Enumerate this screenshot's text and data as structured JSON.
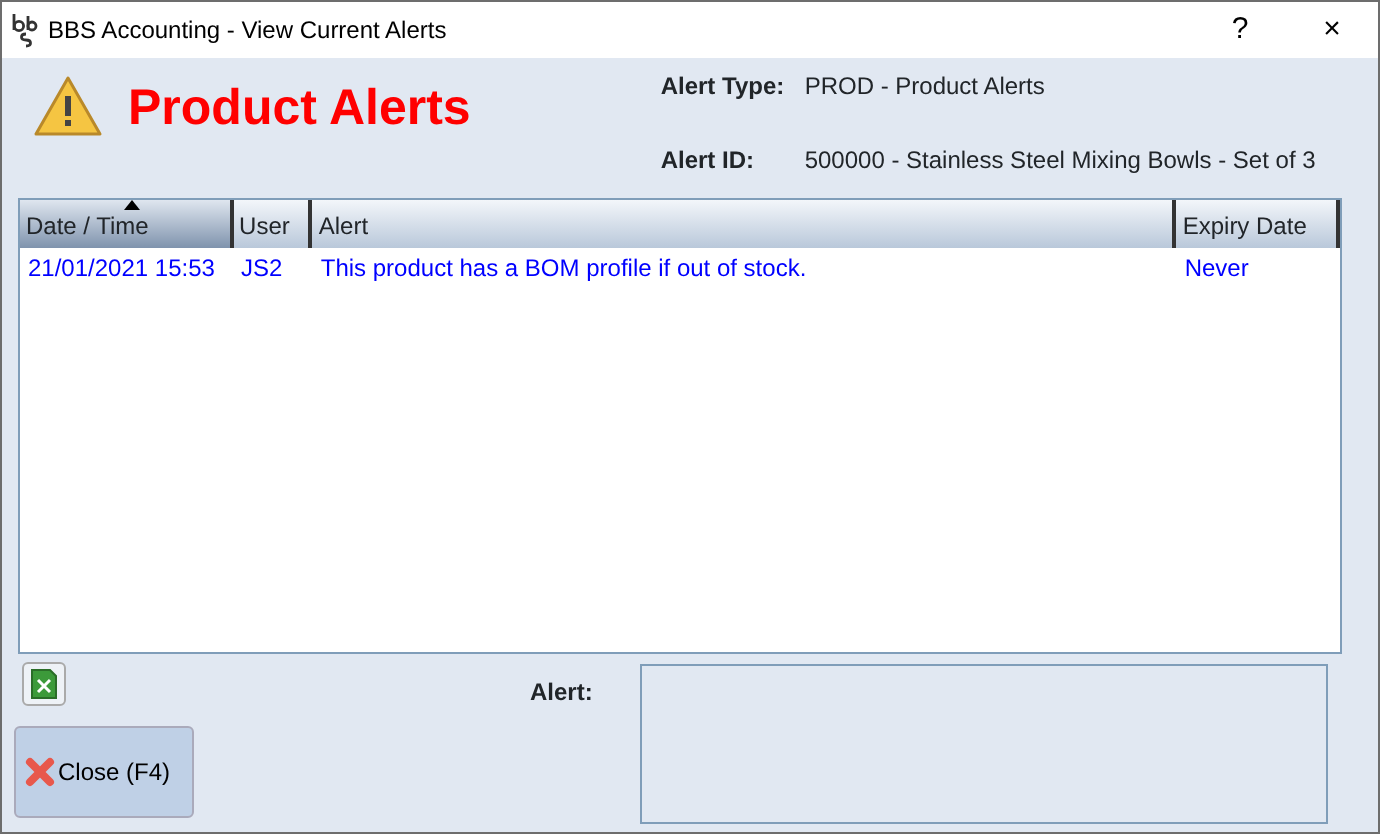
{
  "window": {
    "title": "BBS Accounting - View Current Alerts",
    "help": "?",
    "close": "×"
  },
  "heading": "Product Alerts",
  "fields": [
    {
      "label": "Alert Type:",
      "value": "PROD - Product Alerts"
    },
    {
      "label": "Alert ID:",
      "value": "500000 - Stainless Steel Mixing Bowls - Set of 3"
    }
  ],
  "table": {
    "columns": [
      {
        "label": "Date / Time",
        "sorted": true
      },
      {
        "label": "User",
        "sorted": false
      },
      {
        "label": "Alert",
        "sorted": false
      },
      {
        "label": "Expiry Date",
        "sorted": false
      }
    ],
    "rows": [
      {
        "cells": [
          "21/01/2021 15:53",
          "JS2",
          "This product has a BOM profile if out of stock.",
          "Never"
        ]
      }
    ]
  },
  "alert_label": "Alert:",
  "close_button": "Close (F4)"
}
